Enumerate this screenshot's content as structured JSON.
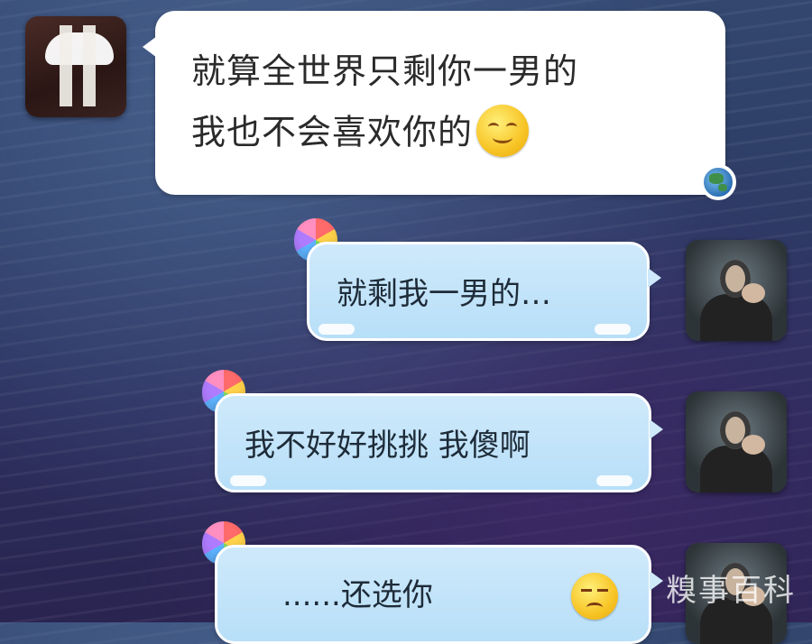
{
  "incoming_message": {
    "line1": "就算全世界只剩你一男的",
    "line2": "我也不会喜欢你的",
    "emoji": "smiling-face-icon",
    "status_icon": "globe-icon"
  },
  "outgoing_messages": [
    {
      "text": "就剩我一男的…",
      "decoration": "rainbow-balloon-icon"
    },
    {
      "text": "我不好好挑挑 我傻啊",
      "decoration": "rainbow-balloon-icon"
    },
    {
      "text": "......还选你",
      "emoji": "unamused-face-icon",
      "decoration": "rainbow-balloon-icon"
    }
  ],
  "watermark": "糗事百科",
  "colors": {
    "incoming_bubble": "#ffffff",
    "outgoing_bubble": "#cfe9fb",
    "text": "#2a2a2a"
  }
}
